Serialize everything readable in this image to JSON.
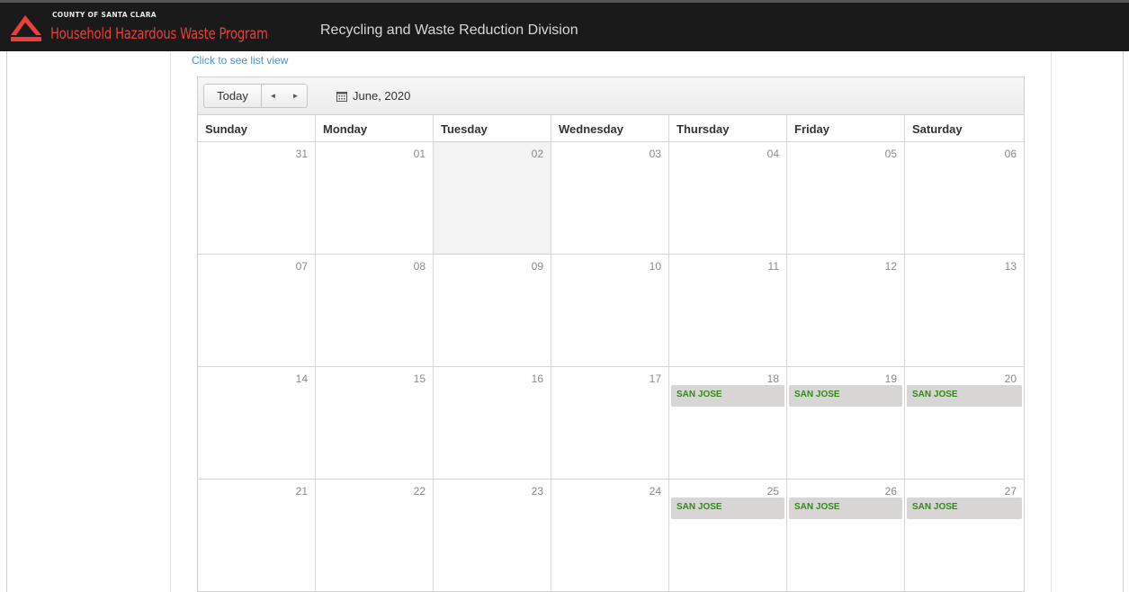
{
  "header": {
    "county": "COUNTY OF SANTA CLARA",
    "program": "Household Hazardous Waste Program",
    "division": "Recycling and Waste Reduction Division"
  },
  "list_view_link": "Click to see list view",
  "toolbar": {
    "today_label": "Today",
    "prev_label": "◄",
    "next_label": "►",
    "month": "June, 2020"
  },
  "weekdays": [
    "Sunday",
    "Monday",
    "Tuesday",
    "Wednesday",
    "Thursday",
    "Friday",
    "Saturday"
  ],
  "weeks": [
    {
      "days": [
        {
          "num": "31"
        },
        {
          "num": "01"
        },
        {
          "num": "02",
          "today": true
        },
        {
          "num": "03"
        },
        {
          "num": "04"
        },
        {
          "num": "05"
        },
        {
          "num": "06"
        }
      ]
    },
    {
      "days": [
        {
          "num": "07"
        },
        {
          "num": "08"
        },
        {
          "num": "09"
        },
        {
          "num": "10"
        },
        {
          "num": "11"
        },
        {
          "num": "12"
        },
        {
          "num": "13"
        }
      ]
    },
    {
      "days": [
        {
          "num": "14"
        },
        {
          "num": "15"
        },
        {
          "num": "16"
        },
        {
          "num": "17"
        },
        {
          "num": "18",
          "event": "SAN JOSE"
        },
        {
          "num": "19",
          "event": "SAN JOSE"
        },
        {
          "num": "20",
          "event": "SAN JOSE"
        }
      ]
    },
    {
      "days": [
        {
          "num": "21"
        },
        {
          "num": "22"
        },
        {
          "num": "23"
        },
        {
          "num": "24"
        },
        {
          "num": "25",
          "event": "SAN JOSE"
        },
        {
          "num": "26",
          "event": "SAN JOSE"
        },
        {
          "num": "27",
          "event": "SAN JOSE"
        }
      ]
    }
  ],
  "colors": {
    "header_bg": "#1a1a1a",
    "brand_red": "#e8413a",
    "event_text": "#2e8b16",
    "event_bg": "#d8d6d4",
    "link": "#4a90d9"
  },
  "icons": {
    "logo": "county-logo-icon",
    "calendar": "calendar-icon"
  }
}
